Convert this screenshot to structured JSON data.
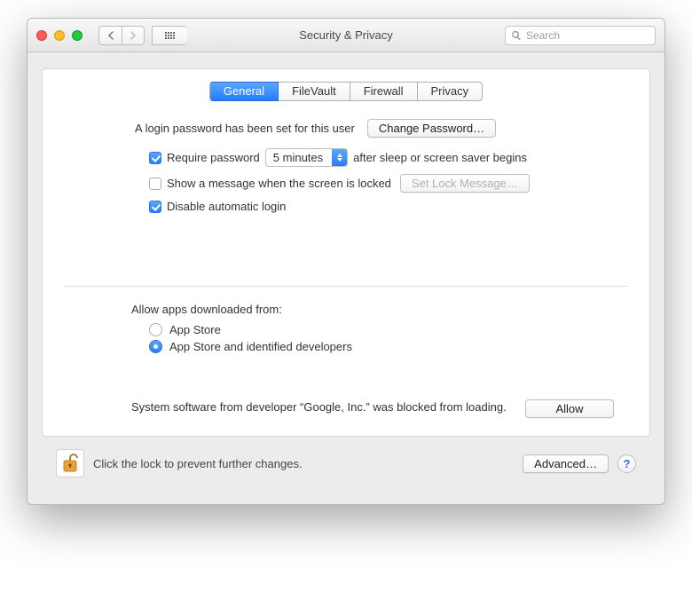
{
  "title": "Security & Privacy",
  "toolbar": {
    "search_placeholder": "Search"
  },
  "tabs": [
    {
      "label": "General",
      "active": true
    },
    {
      "label": "FileVault",
      "active": false
    },
    {
      "label": "Firewall",
      "active": false
    },
    {
      "label": "Privacy",
      "active": false
    }
  ],
  "login": {
    "message": "A login password has been set for this user",
    "change_password_label": "Change Password…",
    "require": {
      "checked": true,
      "prefix": "Require password",
      "select_value": "5 minutes",
      "suffix": "after sleep or screen saver begins"
    },
    "show_message": {
      "checked": false,
      "label": "Show a message when the screen is locked",
      "set_button": "Set Lock Message…",
      "set_button_enabled": false
    },
    "disable_autologin": {
      "checked": true,
      "label": "Disable automatic login"
    }
  },
  "gatekeeper": {
    "heading": "Allow apps downloaded from:",
    "options": [
      {
        "label": "App Store",
        "selected": false
      },
      {
        "label": "App Store and identified developers",
        "selected": true
      }
    ]
  },
  "blocked": {
    "text": "System software from developer “Google, Inc.” was blocked from loading.",
    "allow_label": "Allow"
  },
  "footer": {
    "lock_message": "Click the lock to prevent further changes.",
    "advanced_label": "Advanced…",
    "help_label": "?"
  }
}
